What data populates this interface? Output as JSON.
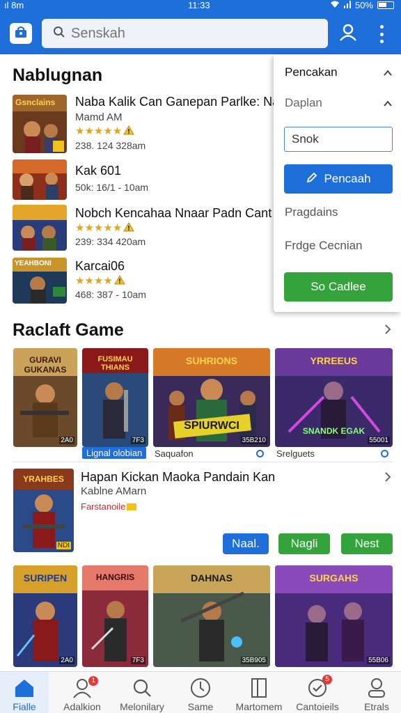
{
  "status_bar": {
    "carrier": "ıl 8m",
    "time": "11:33",
    "battery": "50%"
  },
  "search": {
    "placeholder": "Senskah"
  },
  "section1": {
    "title": "Nablugnan",
    "items": [
      {
        "thumb_text": "Gsnclains",
        "title": "Naba Kalik Can Ganepan Parlke: Na",
        "subtitle": "Mamd AM",
        "stars": "★★★★★",
        "meta": "238. 124 328am"
      },
      {
        "thumb_text": "",
        "title": "Kak 601",
        "subtitle": "",
        "stars": "",
        "meta": "50k: 16/1 - 10am"
      },
      {
        "thumb_text": "",
        "title": "Nobch Kencahaa Nnaar Padn Cant",
        "subtitle": "",
        "stars": "★★★★★",
        "meta": "239: 334 420am"
      },
      {
        "thumb_text": "YEAHBONI",
        "title": "Karcai06",
        "subtitle": "",
        "stars": "★★★★",
        "meta": "468: 387 - 10am"
      }
    ]
  },
  "panel": {
    "heading": "Pencakan",
    "subheading": "Daplan",
    "input_value": "Snok",
    "primary_button": "Pencaah",
    "option1": "Pragdains",
    "option2": "Frdge Cecnian",
    "secondary_button": "So Cadlee"
  },
  "section2": {
    "title": "Raclaft Game",
    "row1": [
      {
        "art": "GURAVI GUKANAS",
        "tag": "2A0"
      },
      {
        "art": "FUSIMAU THIANS",
        "tag": "7F3",
        "caption": "Lignal olobian"
      },
      {
        "art": "SUHRIONS",
        "subart": "SPIURWCI",
        "tag": "35B210",
        "caption": "Saquafon"
      },
      {
        "art": "YRREEUS",
        "subart": "SNANDK EGAK",
        "tag": "55001",
        "caption": "Srelguets"
      }
    ],
    "feature": {
      "art": "YRAHBES",
      "tag": "NDI",
      "title": "Hapan Kickan Maoka Pandain Kan",
      "subtitle": "Kablne AMarn",
      "publisher": "Farstanoile",
      "chips": [
        "Naal.",
        "Nagli",
        "Nest"
      ]
    },
    "row2": [
      {
        "art": "SURIPEN",
        "tag": "2A0"
      },
      {
        "art": "HANGRIS",
        "tag": "7F3"
      },
      {
        "art": "DAHNAS",
        "tag": "35B905"
      },
      {
        "art": "SURGAHS",
        "tag": "55B06"
      }
    ]
  },
  "bottom_nav": [
    {
      "label": "Fialle",
      "icon": "home-icon",
      "badge": ""
    },
    {
      "label": "Adalkion",
      "icon": "profile-icon",
      "badge": "1"
    },
    {
      "label": "Melonilary",
      "icon": "search-icon",
      "badge": ""
    },
    {
      "label": "Same",
      "icon": "clock-icon",
      "badge": ""
    },
    {
      "label": "Martomem",
      "icon": "book-icon",
      "badge": ""
    },
    {
      "label": "Cantoieils",
      "icon": "check-icon",
      "badge": "5"
    },
    {
      "label": "Etrals",
      "icon": "person-icon",
      "badge": ""
    }
  ],
  "colors": {
    "primary": "#1e6fd9",
    "green": "#34a33b",
    "star": "#e3a51c",
    "badge": "#e53935"
  }
}
